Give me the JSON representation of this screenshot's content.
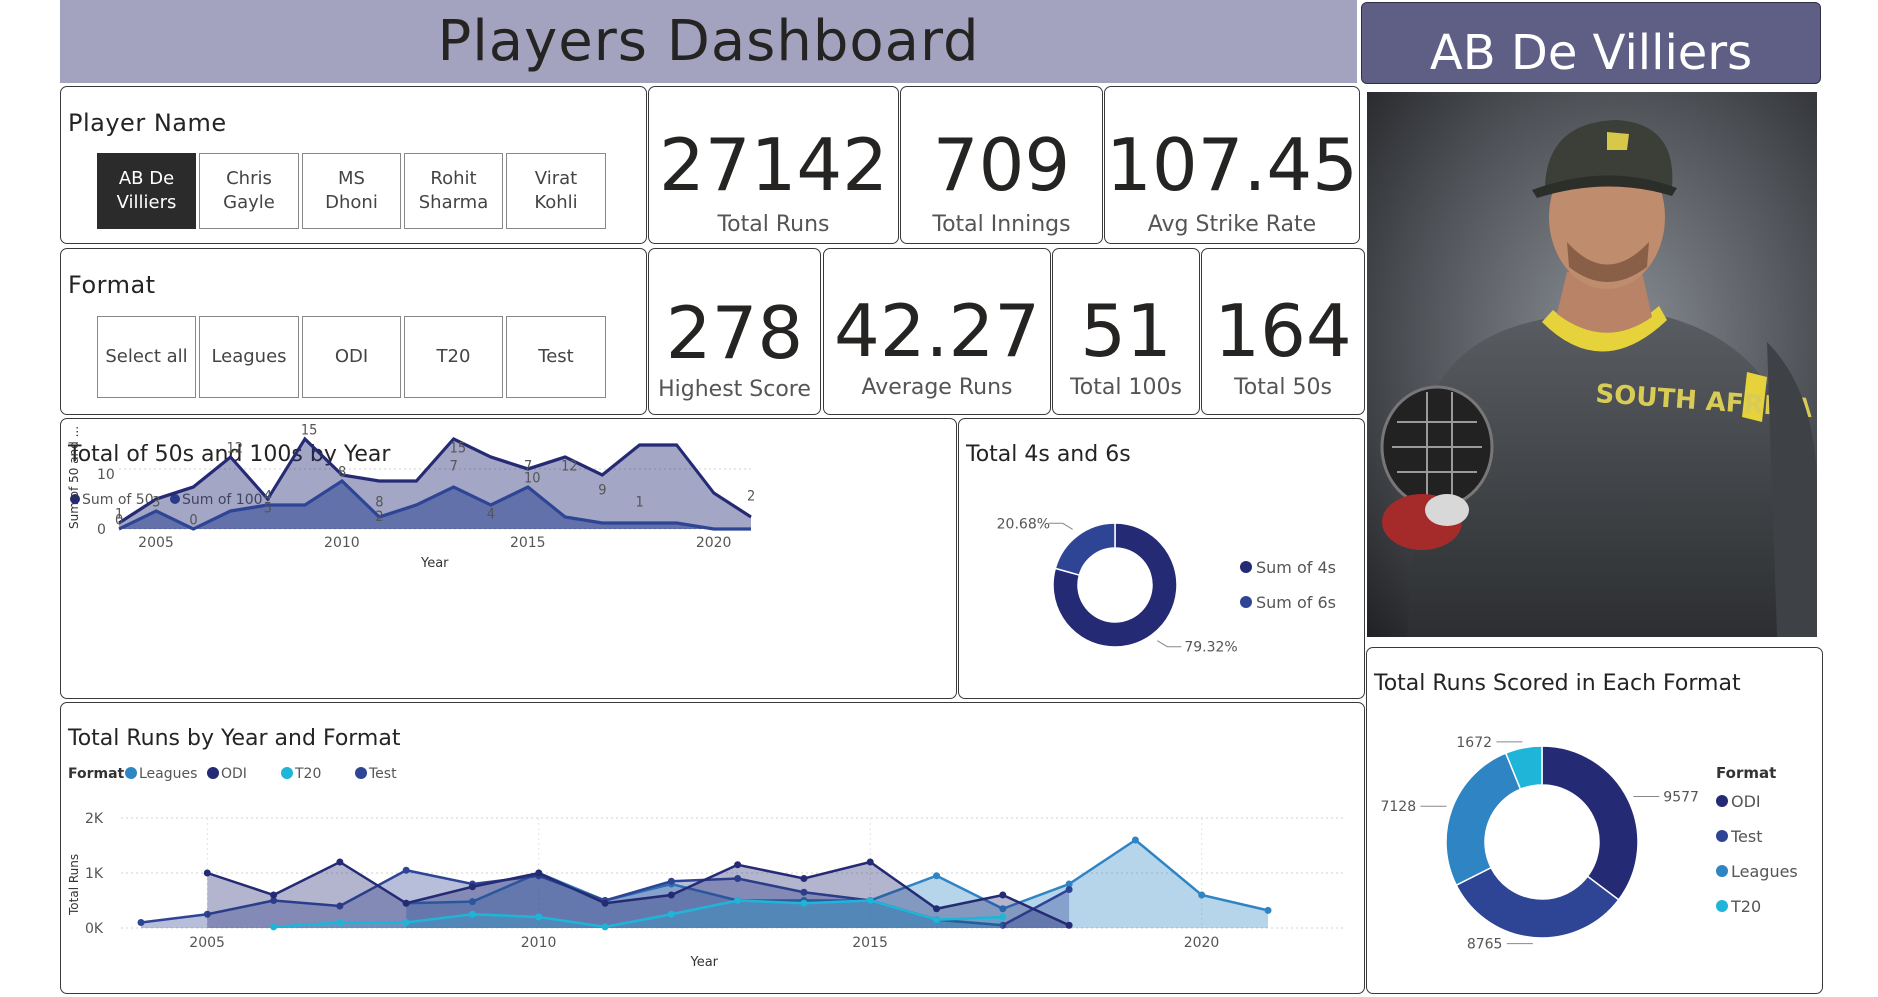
{
  "header": {
    "title": "Players Dashboard",
    "player_name": "AB De Villiers"
  },
  "player_slicer": {
    "title": "Player Name",
    "options": [
      "AB De\nVilliers",
      "Chris\nGayle",
      "MS\nDhoni",
      "Rohit\nSharma",
      "Virat\nKohli"
    ],
    "selected": "AB De\nVilliers"
  },
  "format_slicer": {
    "title": "Format",
    "options": [
      "Select all",
      "Leagues",
      "ODI",
      "T20",
      "Test"
    ]
  },
  "kpis": {
    "total_runs": {
      "value": "27142",
      "label": "Total Runs"
    },
    "total_innings": {
      "value": "709",
      "label": "Total Innings"
    },
    "avg_strike_rate": {
      "value": "107.45",
      "label": "Avg Strike Rate"
    },
    "highest_score": {
      "value": "278",
      "label": "Highest Score"
    },
    "average_runs": {
      "value": "42.27",
      "label": "Average Runs"
    },
    "total_100s": {
      "value": "51",
      "label": "Total 100s"
    },
    "total_50s": {
      "value": "164",
      "label": "Total 50s"
    }
  },
  "photo": {
    "jersey_text": "SOUTH AFRICA"
  },
  "colors": {
    "dark_navy": "#242a73",
    "navy": "#2e4596",
    "mid_blue": "#2f84c4",
    "cyan": "#1fb5d8",
    "title_bar": "#a3a3bf",
    "name_box": "#5f5f86"
  },
  "chart_data": [
    {
      "type": "area",
      "title": "Total of 50s and 100s by Year",
      "xlabel": "Year",
      "ylabel": "Sum of 50 and ...",
      "x_ticks": [
        "2005",
        "2010",
        "2015",
        "2020"
      ],
      "y_ticks": [
        "0",
        "10"
      ],
      "ylim": [
        0,
        16
      ],
      "legend_position": "top-left",
      "x": [
        2004,
        2005,
        2006,
        2007,
        2008,
        2009,
        2010,
        2011,
        2012,
        2013,
        2014,
        2015,
        2016,
        2017,
        2018,
        2019,
        2020,
        2021
      ],
      "series": [
        {
          "name": "Sum of 50",
          "color": "#242a73",
          "values": [
            1,
            5,
            7,
            12,
            5,
            15,
            9,
            8,
            8,
            15,
            12,
            10,
            12,
            9,
            14,
            14,
            6,
            2
          ]
        },
        {
          "name": "Sum of 100",
          "color": "#2e4596",
          "values": [
            0,
            3,
            0,
            3,
            4,
            4,
            8,
            2,
            4,
            7,
            4,
            7,
            2,
            1,
            1,
            1,
            0,
            0
          ]
        }
      ],
      "data_labels": [
        {
          "x": 2004,
          "text": "1",
          "at": 1
        },
        {
          "x": 2004,
          "text": "0",
          "at": 0
        },
        {
          "x": 2005,
          "text": "3",
          "at": 3
        },
        {
          "x": 2006,
          "text": "0",
          "at": 0
        },
        {
          "x": 2007,
          "text": "12",
          "at": 12
        },
        {
          "x": 2008,
          "text": "4",
          "at": 4
        },
        {
          "x": 2008,
          "text": "5",
          "at": 2
        },
        {
          "x": 2009,
          "text": "15",
          "at": 15
        },
        {
          "x": 2010,
          "text": "8",
          "at": 8
        },
        {
          "x": 2011,
          "text": "8",
          "at": 3
        },
        {
          "x": 2011,
          "text": "2",
          "at": 0.6
        },
        {
          "x": 2013,
          "text": "15",
          "at": 12
        },
        {
          "x": 2013,
          "text": "7",
          "at": 9
        },
        {
          "x": 2014,
          "text": "4",
          "at": 1
        },
        {
          "x": 2015,
          "text": "7",
          "at": 9
        },
        {
          "x": 2015,
          "text": "10",
          "at": 7
        },
        {
          "x": 2016,
          "text": "12",
          "at": 9
        },
        {
          "x": 2017,
          "text": "9",
          "at": 5
        },
        {
          "x": 2018,
          "text": "1",
          "at": 3
        },
        {
          "x": 2021,
          "text": "2",
          "at": 4
        }
      ]
    },
    {
      "type": "pie",
      "title": "Total 4s and 6s",
      "legend_position": "right",
      "slices": [
        {
          "name": "Sum of 4s",
          "value": 79.32,
          "label": "79.32%",
          "color": "#242a73"
        },
        {
          "name": "Sum of 6s",
          "value": 20.68,
          "label": "20.68%",
          "color": "#2e4596"
        }
      ]
    },
    {
      "type": "area",
      "title": "Total Runs by Year and Format",
      "xlabel": "Year",
      "ylabel": "Total Runs",
      "legend_title": "Format",
      "legend_position": "top-left",
      "x_ticks": [
        "2005",
        "2010",
        "2015",
        "2020"
      ],
      "y_ticks": [
        "0K",
        "1K",
        "2K"
      ],
      "ylim": [
        0,
        2000
      ],
      "x": [
        2004,
        2005,
        2006,
        2007,
        2008,
        2009,
        2010,
        2011,
        2012,
        2013,
        2014,
        2015,
        2016,
        2017,
        2018,
        2019,
        2020,
        2021
      ],
      "series": [
        {
          "name": "Leagues",
          "color": "#2f84c4",
          "values": [
            null,
            null,
            null,
            null,
            450,
            480,
            1000,
            500,
            800,
            500,
            500,
            500,
            950,
            350,
            800,
            1600,
            600,
            320
          ]
        },
        {
          "name": "ODI",
          "color": "#242a73",
          "values": [
            null,
            1000,
            600,
            1200,
            450,
            750,
            1000,
            450,
            600,
            1150,
            900,
            1200,
            350,
            600,
            50,
            null,
            null,
            null
          ]
        },
        {
          "name": "T20",
          "color": "#1fb5d8",
          "values": [
            null,
            null,
            20,
            100,
            100,
            250,
            200,
            20,
            250,
            500,
            450,
            500,
            150,
            200,
            null,
            null,
            null,
            null
          ]
        },
        {
          "name": "Test",
          "color": "#2e4596",
          "values": [
            100,
            250,
            500,
            400,
            1050,
            800,
            950,
            500,
            850,
            900,
            650,
            500,
            150,
            50,
            700,
            null,
            null,
            null
          ]
        }
      ]
    },
    {
      "type": "pie",
      "title": "Total Runs Scored in Each Format",
      "legend_title": "Format",
      "legend_position": "right",
      "slices": [
        {
          "name": "ODI",
          "value": 9577,
          "label": "9577",
          "color": "#242a73"
        },
        {
          "name": "Test",
          "value": 8765,
          "label": "8765",
          "color": "#2e4596"
        },
        {
          "name": "Leagues",
          "value": 7128,
          "label": "7128",
          "color": "#2f84c4"
        },
        {
          "name": "T20",
          "value": 1672,
          "label": "1672",
          "color": "#1fb5d8"
        }
      ]
    }
  ]
}
